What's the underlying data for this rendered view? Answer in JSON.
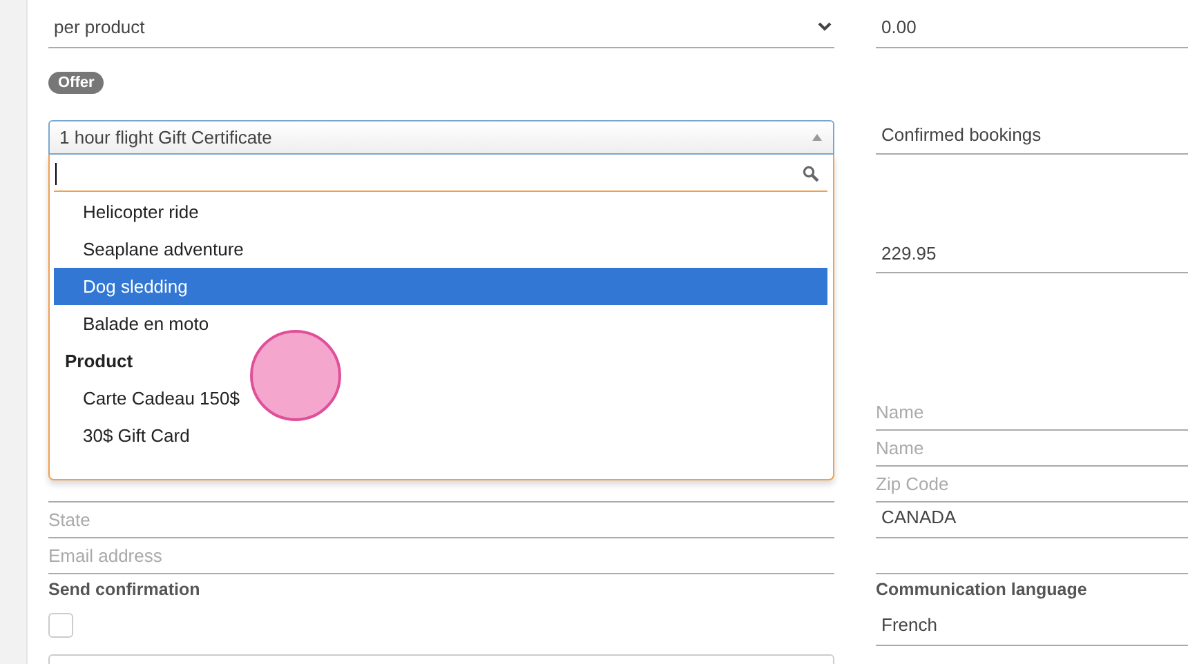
{
  "rows": [
    {
      "left": {
        "kind": "select",
        "value": "per product"
      },
      "right": {
        "kind": "text",
        "value": "0.00"
      }
    },
    {
      "left": {
        "kind": "badge",
        "value": "Offer"
      }
    },
    {
      "left": {
        "kind": "combo",
        "value": "1 hour flight Gift Certificate",
        "expanded": true
      },
      "right": {
        "kind": "text",
        "value": "Confirmed bookings"
      }
    },
    {
      "right": {
        "kind": "text",
        "value": "229.95"
      }
    },
    {},
    {
      "right": {
        "kind": "placeholder",
        "placeholder": "Name"
      }
    },
    {
      "right": {
        "kind": "placeholder",
        "placeholder": "Name"
      }
    },
    {
      "left": {
        "kind": "blank"
      },
      "right": {
        "kind": "placeholder",
        "placeholder": "Zip Code"
      }
    },
    {
      "left": {
        "kind": "placeholder",
        "placeholder": "State"
      },
      "right": {
        "kind": "text",
        "value": "CANADA"
      }
    },
    {
      "left": {
        "kind": "placeholder",
        "placeholder": "Email address"
      },
      "right": {
        "kind": "blank"
      }
    },
    {
      "left": {
        "kind": "label",
        "value": "Send confirmation"
      },
      "right": {
        "kind": "label",
        "value": "Communication language"
      }
    },
    {
      "left": {
        "kind": "checkbox",
        "checked": false
      },
      "right": {
        "kind": "text",
        "value": "French"
      }
    }
  ],
  "dropdown": {
    "options": [
      {
        "kind": "option",
        "label": "Helicopter ride",
        "selected": false
      },
      {
        "kind": "option",
        "label": "Seaplane adventure",
        "selected": false
      },
      {
        "kind": "option",
        "label": "Dog sledding",
        "selected": true
      },
      {
        "kind": "option",
        "label": "Balade en moto",
        "selected": false
      },
      {
        "kind": "group",
        "label": "Product"
      },
      {
        "kind": "option",
        "label": "Carte Cadeau 150$",
        "selected": false
      },
      {
        "kind": "option",
        "label": "30$ Gift Card",
        "selected": false
      }
    ]
  },
  "click_indicator": true
}
